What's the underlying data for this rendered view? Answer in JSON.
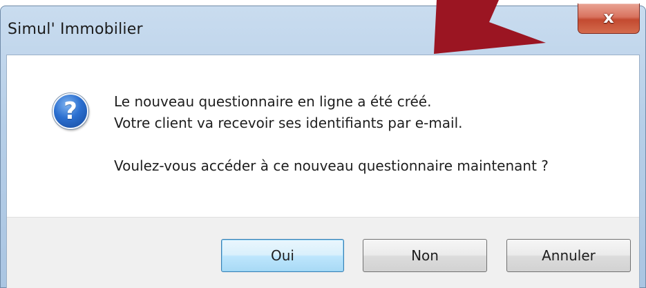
{
  "window": {
    "title": "Simul' Immobilier",
    "close_label": "x"
  },
  "message": {
    "icon": "question-icon",
    "line1": "Le nouveau questionnaire en ligne a été créé.",
    "line2": "Votre client va recevoir ses identifiants par e-mail.",
    "line3": "Voulez-vous accéder à ce nouveau questionnaire maintenant ?"
  },
  "buttons": {
    "yes_label": "Oui",
    "no_label": "Non",
    "cancel_label": "Annuler"
  },
  "colors": {
    "annotation_arrow": "#9b1522",
    "default_button_border": "#3c7fb1"
  }
}
